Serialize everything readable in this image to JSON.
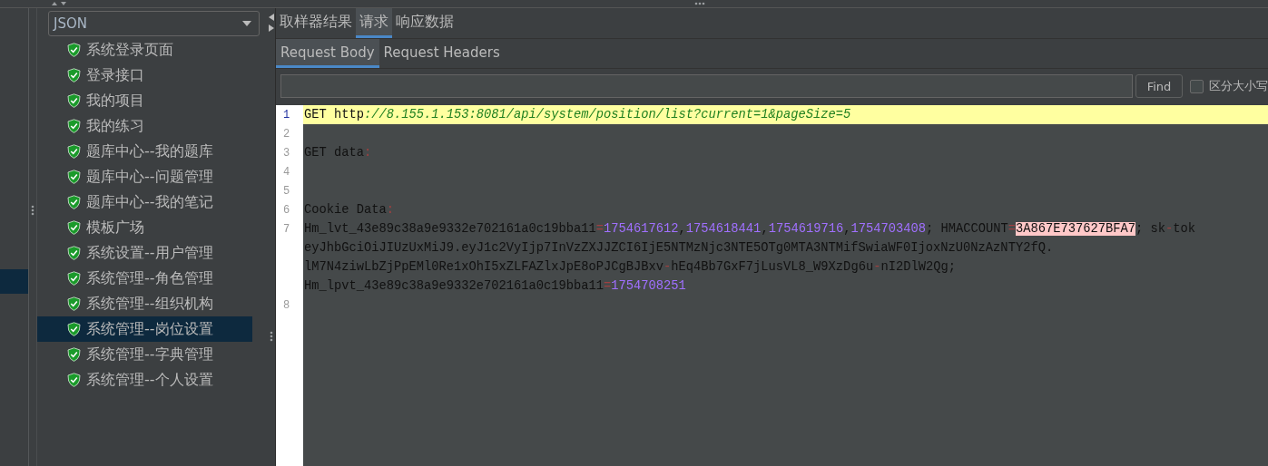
{
  "filter_dropdown": {
    "value": "JSON"
  },
  "tree": {
    "items": [
      {
        "label": "系统登录页面",
        "selected": false
      },
      {
        "label": "登录接口",
        "selected": false
      },
      {
        "label": "我的项目",
        "selected": false
      },
      {
        "label": "我的练习",
        "selected": false
      },
      {
        "label": "题库中心--我的题库",
        "selected": false
      },
      {
        "label": "题库中心--问题管理",
        "selected": false
      },
      {
        "label": "题库中心--我的笔记",
        "selected": false
      },
      {
        "label": "模板广场",
        "selected": false
      },
      {
        "label": "系统设置--用户管理",
        "selected": false
      },
      {
        "label": "系统管理--角色管理",
        "selected": false
      },
      {
        "label": "系统管理--组织机构",
        "selected": false
      },
      {
        "label": "系统管理--岗位设置",
        "selected": true
      },
      {
        "label": "系统管理--字典管理",
        "selected": false
      },
      {
        "label": "系统管理--个人设置",
        "selected": false
      }
    ]
  },
  "tabs": [
    {
      "label": "取样器结果",
      "selected": false
    },
    {
      "label": "请求",
      "selected": true
    },
    {
      "label": "响应数据",
      "selected": false
    }
  ],
  "subtabs": [
    {
      "label": "Request Body",
      "selected": true
    },
    {
      "label": "Request Headers",
      "selected": false
    }
  ],
  "search": {
    "button": "Find",
    "match_case": {
      "label": "区分大小写",
      "checked": false
    }
  },
  "editor": {
    "lines": [
      {
        "number": "1",
        "current": true,
        "rows": [
          {
            "segments": [
              {
                "kind": "plain",
                "text": "GET http"
              },
              {
                "kind": "url",
                "text": "://8.155.1.153:8081/api/system/position/list?current=1&pageSize=5"
              }
            ]
          }
        ]
      },
      {
        "number": "2",
        "current": false,
        "rows": [
          {
            "segments": []
          }
        ]
      },
      {
        "number": "3",
        "current": false,
        "rows": [
          {
            "segments": [
              {
                "kind": "plain",
                "text": "GET data"
              },
              {
                "kind": "punct",
                "text": ":"
              }
            ]
          }
        ]
      },
      {
        "number": "4",
        "current": false,
        "rows": [
          {
            "segments": []
          }
        ]
      },
      {
        "number": "5",
        "current": false,
        "rows": [
          {
            "segments": []
          }
        ]
      },
      {
        "number": "6",
        "current": false,
        "rows": [
          {
            "segments": [
              {
                "kind": "plain",
                "text": "Cookie Data"
              },
              {
                "kind": "punct",
                "text": ":"
              }
            ]
          }
        ]
      },
      {
        "number": "7",
        "current": false,
        "rows": [
          {
            "segments": [
              {
                "kind": "plain",
                "text": "Hm_lvt_43e89c38a9e9332e702161a0c19bba11"
              },
              {
                "kind": "punct",
                "text": "="
              },
              {
                "kind": "number",
                "text": "1754617612"
              },
              {
                "kind": "plain",
                "text": ","
              },
              {
                "kind": "number",
                "text": "1754618441"
              },
              {
                "kind": "plain",
                "text": ","
              },
              {
                "kind": "number",
                "text": "1754619716"
              },
              {
                "kind": "plain",
                "text": ","
              },
              {
                "kind": "number",
                "text": "1754703408"
              },
              {
                "kind": "plain",
                "text": "; HMACCOUNT"
              },
              {
                "kind": "punct",
                "text": "="
              },
              {
                "kind": "match",
                "text": "3A867E737627BFA7"
              },
              {
                "kind": "plain",
                "text": "; sk"
              },
              {
                "kind": "punct",
                "text": "-"
              },
              {
                "kind": "plain",
                "text": "tok"
              }
            ]
          },
          {
            "segments": [
              {
                "kind": "plain",
                "text": "eyJhbGciOiJIUzUxMiJ9.eyJ1c2VyIjp7InVzZXJJZCI6IjE5NTMzNjc3NTE5OTg0MTA3NTMifSwiaWF0IjoxNzU0NzAzNTY2fQ."
              }
            ]
          },
          {
            "segments": [
              {
                "kind": "plain",
                "text": "lM7N4ziwLbZjPpEMl0Re1xOhI5xZLFAZlxJpE8oPJCgBJBxv"
              },
              {
                "kind": "punct",
                "text": "-"
              },
              {
                "kind": "plain",
                "text": "hEq4Bb7GxF7jLusVL8_W9XzDg6u"
              },
              {
                "kind": "punct",
                "text": "-"
              },
              {
                "kind": "plain",
                "text": "nI2DlW2Qg;"
              }
            ]
          },
          {
            "segments": [
              {
                "kind": "plain",
                "text": "Hm_lpvt_43e89c38a9e9332e702161a0c19bba11"
              },
              {
                "kind": "punct",
                "text": "="
              },
              {
                "kind": "number",
                "text": "1754708251"
              }
            ]
          }
        ]
      },
      {
        "number": "8",
        "current": false,
        "rows": [
          {
            "segments": []
          }
        ]
      }
    ]
  }
}
